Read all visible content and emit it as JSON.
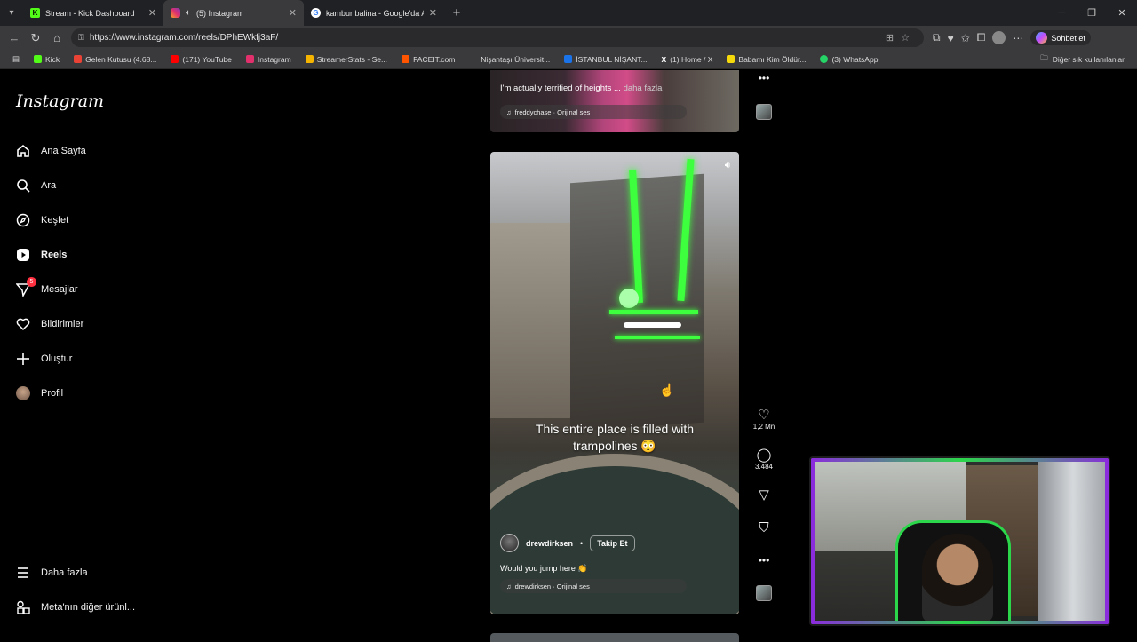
{
  "browser": {
    "tabs": [
      {
        "title": "Stream - Kick Dashboard",
        "icon": "kick-icon",
        "color": "#53fc18",
        "active": false
      },
      {
        "title": "(5) Instagram",
        "icon": "instagram-icon",
        "color": "#e1306c",
        "active": true
      },
      {
        "title": "kambur balina - Google'da Ara",
        "icon": "google-icon",
        "color": "#4285f4",
        "active": false
      }
    ],
    "url": "https://www.instagram.com/reels/DPhEWkfj3aF/",
    "copilot_label": "Sohbet et",
    "bookmarks": [
      {
        "label": "Kick",
        "color": "#53fc18"
      },
      {
        "label": "Gelen Kutusu (4.68...",
        "color": "#ea4335"
      },
      {
        "label": "(171) YouTube",
        "color": "#ff0000"
      },
      {
        "label": "Instagram",
        "color": "#e1306c"
      },
      {
        "label": "StreamerStats - Se...",
        "color": "#f4b400"
      },
      {
        "label": "FACEIT.com",
        "color": "#ff5500"
      },
      {
        "label": "Nişantaşı Üniversit...",
        "color": "#3a3a3d"
      },
      {
        "label": "İSTANBUL NİŞANT...",
        "color": "#1a73e8"
      },
      {
        "label": "(1) Home / X",
        "color": "#ffffff"
      },
      {
        "label": "Babamı Kim Öldür...",
        "color": "#f5d90a"
      },
      {
        "label": "(3) WhatsApp",
        "color": "#25d366"
      }
    ],
    "bookmarks_other": "Diğer sık kullanılanlar"
  },
  "instagram": {
    "logo": "Instagram",
    "nav": [
      {
        "label": "Ana Sayfa",
        "icon": "home-icon"
      },
      {
        "label": "Ara",
        "icon": "search-icon"
      },
      {
        "label": "Keşfet",
        "icon": "compass-icon"
      },
      {
        "label": "Reels",
        "icon": "reels-icon"
      },
      {
        "label": "Mesajlar",
        "icon": "messenger-icon",
        "badge": "5"
      },
      {
        "label": "Bildirimler",
        "icon": "heart-icon"
      },
      {
        "label": "Oluştur",
        "icon": "plus-icon"
      },
      {
        "label": "Profil",
        "icon": "profile-avatar"
      }
    ],
    "more": "Daha fazla",
    "meta": "Meta'nın diğer ürünl..."
  },
  "prev_reel": {
    "caption": "I'm actually terrified of heights ...",
    "more": "daha fazla",
    "audio": "freddychase · Orijinal ses"
  },
  "reel": {
    "overlay_text_1": "This entire place is filled with",
    "overlay_text_2": "trampolines 😳",
    "username": "drewdirksen",
    "separator": "•",
    "follow": "Takip Et",
    "caption": "Would you jump here 👏",
    "audio": "drewdirksen · Orijinal ses",
    "likes": "1,2 Mn",
    "comments": "3.484"
  }
}
